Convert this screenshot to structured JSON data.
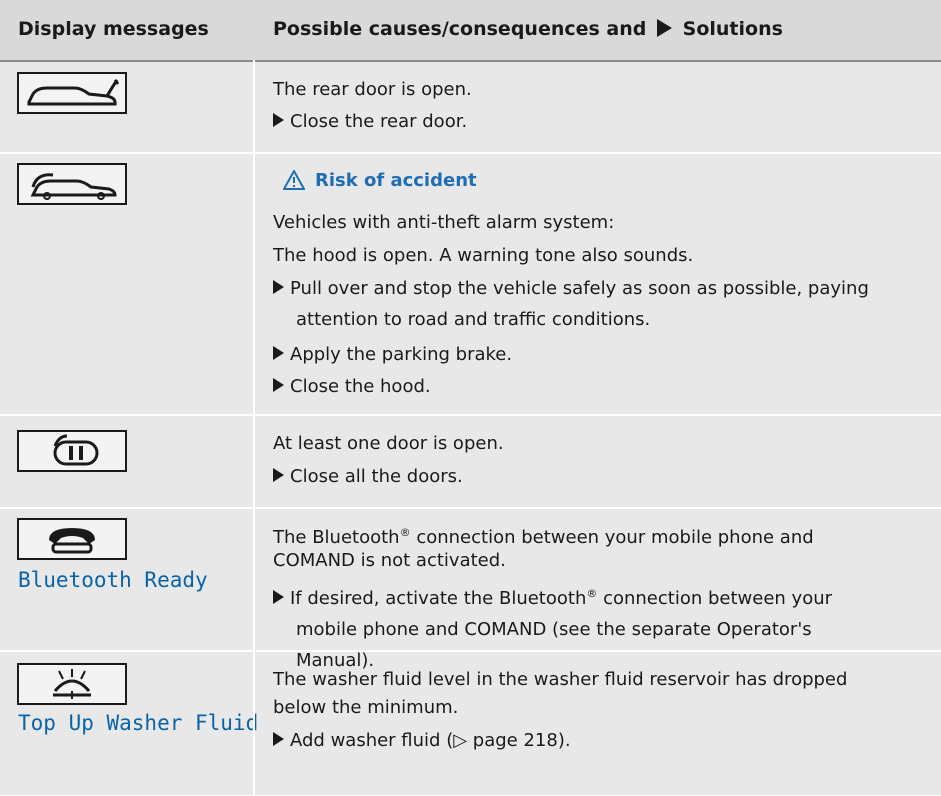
{
  "header": {
    "col1": "Display messages",
    "col2_before": "Possible causes/consequences and",
    "col2_after": "Solutions"
  },
  "rows": [
    {
      "icon": "rear-door-open-icon",
      "cause": "The rear door is open.",
      "solution": "Close the rear door."
    },
    {
      "icon": "hood-open-icon",
      "warning": "Risk of accident",
      "cause_1": "Vehicles with anti-theft alarm system:",
      "cause_2": "The hood is open. A warning tone also sounds.",
      "solution_1a": "Pull over and stop the vehicle safely as soon as possible, paying",
      "solution_1b": "attention to road and traffic conditions.",
      "solution_2": "Apply the parking brake.",
      "solution_3": "Close the hood."
    },
    {
      "icon": "door-open-icon",
      "cause": "At least one door is open.",
      "solution": "Close all the doors."
    },
    {
      "icon": "phone-icon",
      "display": "Bluetooth Ready",
      "cause_a": "The Bluetooth",
      "cause_a_sup": "®",
      "cause_a_rest": " connection between your mobile phone and",
      "cause_b": "COMAND is not activated.",
      "solution_a": "If desired, activate the Bluetooth",
      "solution_a_sup": "®",
      "solution_a_rest": " connection between your",
      "solution_b": "mobile phone and COMAND (see the separate Operator's",
      "solution_c": "Manual)."
    },
    {
      "icon": "washer-fluid-icon",
      "display": "Top Up Washer Fluid",
      "cause_a": "The washer fluid level in the washer fluid reservoir has dropped",
      "cause_b": "below the minimum.",
      "solution": "Add washer fluid (▷ page 218)."
    }
  ]
}
